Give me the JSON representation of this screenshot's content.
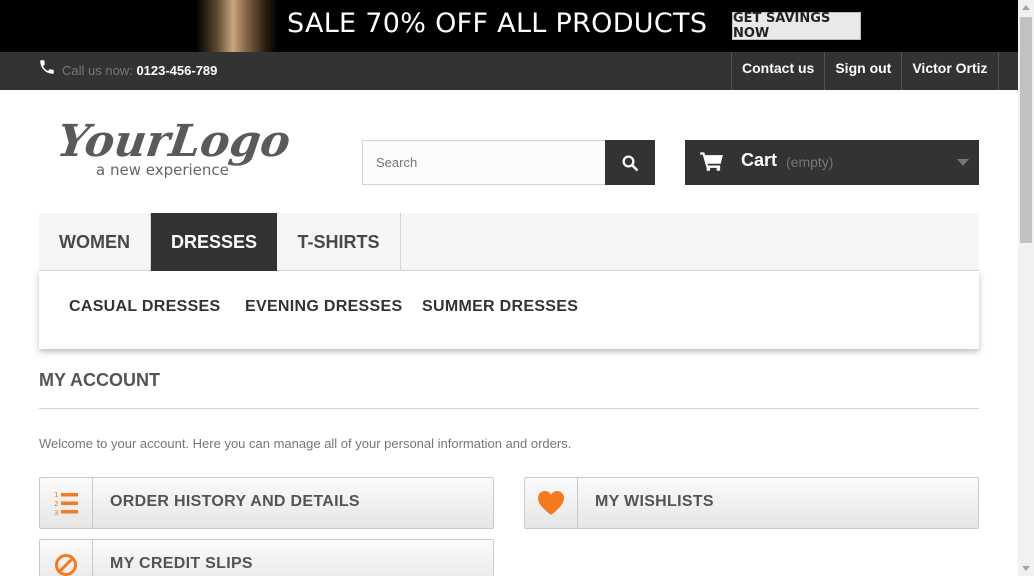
{
  "promo": {
    "headline": "SALE 70% OFF ALL PRODUCTS",
    "button_label": "GET SAVINGS NOW"
  },
  "topbar": {
    "call_prefix": "Call us now:",
    "phone_number": "0123-456-789",
    "links": [
      "Contact us",
      "Sign out",
      "Victor Ortiz"
    ]
  },
  "header": {
    "logo_main": "YourLogo",
    "logo_tagline": "a new experience",
    "search_placeholder": "Search",
    "cart_label": "Cart",
    "cart_status": "(empty)"
  },
  "menu": {
    "tabs": [
      "WOMEN",
      "DRESSES",
      "T-SHIRTS"
    ],
    "active_tab": "DRESSES",
    "submenu": [
      "CASUAL DRESSES",
      "EVENING DRESSES",
      "SUMMER DRESSES"
    ]
  },
  "account": {
    "title": "MY ACCOUNT",
    "welcome": "Welcome to your account. Here you can manage all of your personal information and orders.",
    "buttons": [
      {
        "label": "ORDER HISTORY AND DETAILS",
        "icon": "list-ordered-icon"
      },
      {
        "label": "MY WISHLISTS",
        "icon": "heart-icon"
      },
      {
        "label": "MY CREDIT SLIPS",
        "icon": "ban-icon"
      }
    ]
  },
  "colors": {
    "dark": "#333333",
    "accent_orange": "#f47a20",
    "text_muted": "#777777"
  }
}
